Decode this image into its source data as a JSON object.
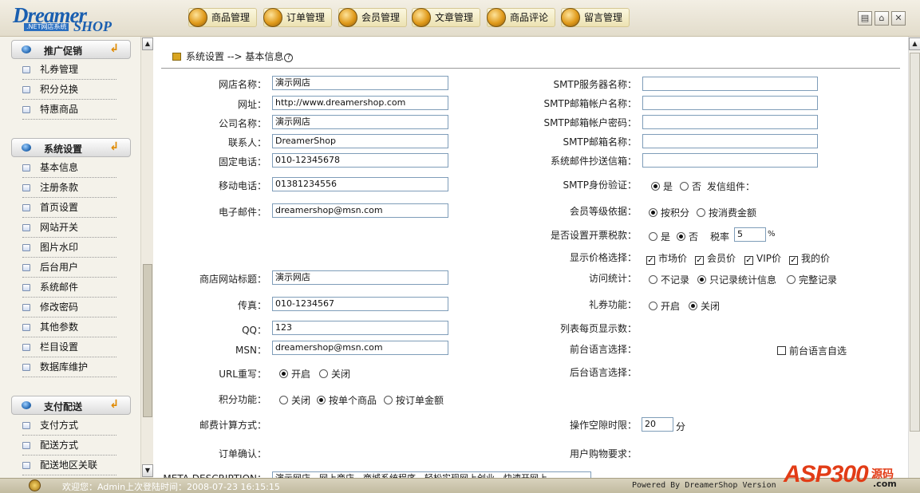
{
  "logo": {
    "main": "Dreamer",
    "sub": ".NET网店系统",
    "shop": "SHOP"
  },
  "nav": [
    "商品管理",
    "订单管理",
    "会员管理",
    "文章管理",
    "商品评论",
    "留言管理"
  ],
  "window_buttons": [
    "restore-icon",
    "home-icon",
    "close-icon"
  ],
  "sidebar": {
    "groups": [
      {
        "title": "推广促销",
        "items": [
          "礼券管理",
          "积分兑换",
          "特惠商品"
        ]
      },
      {
        "title": "系统设置",
        "items": [
          "基本信息",
          "注册条款",
          "首页设置",
          "网站开关",
          "图片水印",
          "后台用户",
          "系统邮件",
          "修改密码",
          "其他参数",
          "栏目设置",
          "数据库维护"
        ]
      },
      {
        "title": "支付配送",
        "items": [
          "支付方式",
          "配送方式",
          "配送地区关联"
        ]
      }
    ]
  },
  "breadcrumb": {
    "text": "系统设置 --> 基本信息",
    "help": "?"
  },
  "left_form": {
    "shop_name": {
      "label": "网店名称：",
      "value": "演示网店"
    },
    "url": {
      "label": "网址：",
      "value": "http://www.dreamershop.com"
    },
    "company": {
      "label": "公司名称：",
      "value": "演示网店"
    },
    "contact": {
      "label": "联系人：",
      "value": "DreamerShop"
    },
    "phone": {
      "label": "固定电话：",
      "value": "010-12345678"
    },
    "mobile": {
      "label": "移动电话：",
      "value": "01381234556"
    },
    "email": {
      "label": "电子邮件：",
      "value": "dreamershop@msn.com"
    },
    "site_title": {
      "label": "商店网站标题：",
      "value": "演示网店"
    },
    "fax": {
      "label": "传真：",
      "value": "010-1234567"
    },
    "qq": {
      "label": "QQ：",
      "value": "123"
    },
    "msn": {
      "label": "MSN：",
      "value": "dreamershop@msn.com"
    },
    "url_rewrite": {
      "label": "URL重写：",
      "opt_on": "开启",
      "opt_off": "关闭"
    },
    "points": {
      "label": "积分功能：",
      "opt1": "关闭",
      "opt2": "按单个商品",
      "opt3": "按订单金额"
    },
    "postage": {
      "label": "邮费计算方式："
    },
    "order_confirm": {
      "label": "订单确认："
    },
    "meta": {
      "label": "META DESCRIPTION：",
      "value": "演示网店，网上商店，商城系统程序，轻松实现网上创业，快速开网上"
    }
  },
  "right_form": {
    "smtp_server": {
      "label": "SMTP服务器名称：",
      "value": ""
    },
    "smtp_account": {
      "label": "SMTP邮箱帐户名称：",
      "value": ""
    },
    "smtp_password": {
      "label": "SMTP邮箱帐户密码：",
      "value": ""
    },
    "smtp_mailbox": {
      "label": "SMTP邮箱名称：",
      "value": ""
    },
    "cc_mailbox": {
      "label": "系统邮件抄送信箱：",
      "value": ""
    },
    "smtp_auth": {
      "label": "SMTP身份验证：",
      "yes": "是",
      "no": "否",
      "component": "发信组件："
    },
    "member_level": {
      "label": "会员等级依据：",
      "opt1": "按积分",
      "opt2": "按消费金额"
    },
    "invoice_tax": {
      "label": "是否设置开票税款：",
      "yes": "是",
      "no": "否",
      "rate_label": "税率",
      "rate_value": "5",
      "unit": "%"
    },
    "price_display": {
      "label": "显示价格选择：",
      "opt1": "市场价",
      "opt2": "会员价",
      "opt3": "VIP价",
      "opt4": "我的价"
    },
    "visit_stats": {
      "label": "访问统计：",
      "opt1": "不记录",
      "opt2": "只记录统计信息",
      "opt3": "完整记录"
    },
    "coupon": {
      "label": "礼券功能：",
      "on": "开启",
      "off": "关闭"
    },
    "list_per_page": {
      "label": "列表每页显示数："
    },
    "front_lang": {
      "label": "前台语言选择：",
      "auto": "前台语言自选"
    },
    "back_lang": {
      "label": "后台语言选择："
    },
    "timeout": {
      "label": "操作空隙时限：",
      "value": "20",
      "unit": "分"
    },
    "user_cart": {
      "label": "用户购物要求："
    }
  },
  "status": {
    "welcome": "欢迎您：Admin上次登陆时间：2008-07-23 16:15:15",
    "powered": "Powered By DreamerShop Version"
  },
  "watermark": {
    "text": "ASP300",
    "suffix": "源码",
    "domain": ".com"
  }
}
